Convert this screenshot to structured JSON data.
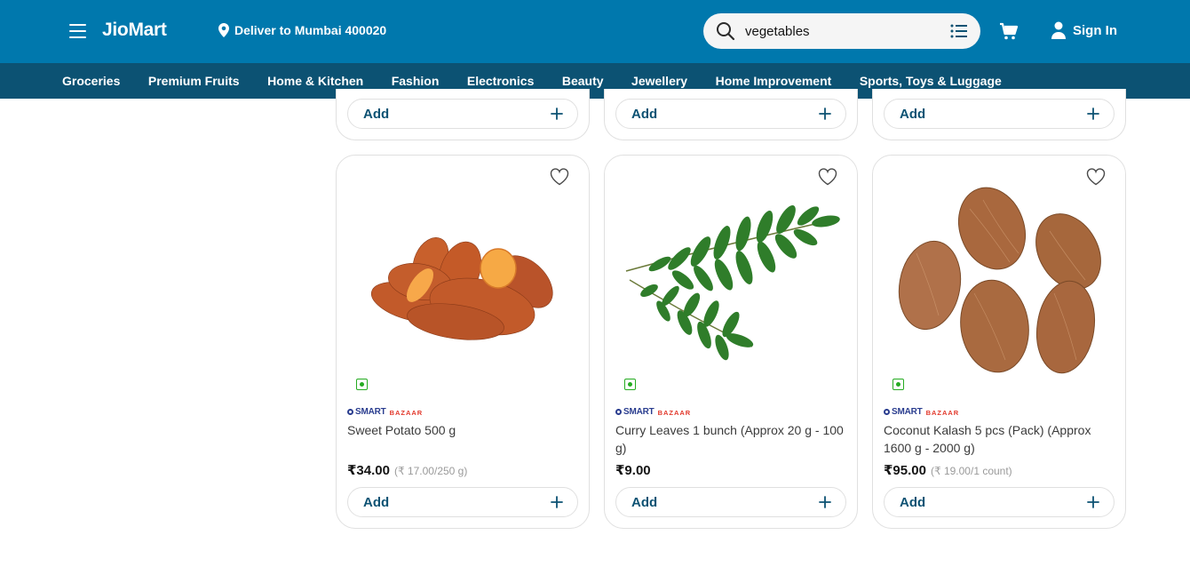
{
  "header": {
    "logo": "JioMart",
    "deliver_to": "Deliver to Mumbai 400020",
    "search_value": "vegetables",
    "sign_in": "Sign In"
  },
  "nav": {
    "items": [
      "Groceries",
      "Premium Fruits",
      "Home & Kitchen",
      "Fashion",
      "Electronics",
      "Beauty",
      "Jewellery",
      "Home Improvement",
      "Sports, Toys & Luggage"
    ]
  },
  "partial_cards": [
    {
      "add_label": "Add"
    },
    {
      "add_label": "Add"
    },
    {
      "add_label": "Add"
    }
  ],
  "products": [
    {
      "brand_main": "SMART",
      "brand_sub": "BAZAAR",
      "title": "Sweet Potato 500 g",
      "price": "₹34.00",
      "unit_price": "(₹ 17.00/250 g)",
      "add_label": "Add"
    },
    {
      "brand_main": "SMART",
      "brand_sub": "BAZAAR",
      "title": "Curry Leaves 1 bunch (Approx 20 g - 100 g)",
      "price": "₹9.00",
      "unit_price": "",
      "add_label": "Add"
    },
    {
      "brand_main": "SMART",
      "brand_sub": "BAZAAR",
      "title": "Coconut Kalash 5 pcs (Pack) (Approx 1600 g - 2000 g)",
      "price": "₹95.00",
      "unit_price": "(₹ 19.00/1 count)",
      "add_label": "Add"
    }
  ],
  "colors": {
    "header_bg": "#0078ad",
    "nav_bg": "#0c5273",
    "veg_green": "#25ab21"
  }
}
